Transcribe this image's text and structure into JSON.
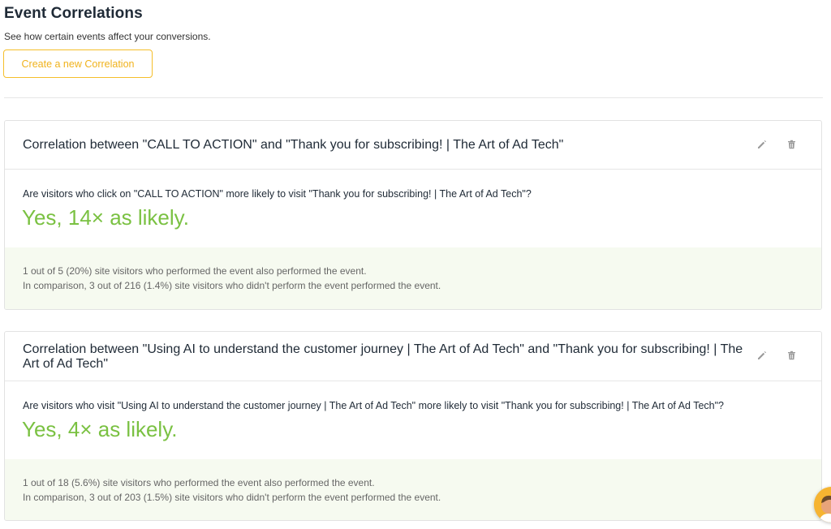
{
  "header": {
    "title": "Event Correlations",
    "subtitle": "See how certain events affect your conversions.",
    "create_button": "Create a new Correlation"
  },
  "correlations": [
    {
      "title": "Correlation between \"CALL TO ACTION\" and \"Thank you for subscribing! | The Art of Ad Tech\"",
      "question": "Are visitors who click on \"CALL TO ACTION\" more likely to visit \"Thank you for subscribing! | The Art of Ad Tech\"?",
      "answer": "Yes, 14× as likely.",
      "stat1": "1 out of 5 (20%) site visitors who performed the event also performed the event.",
      "stat2": "In comparison, 3 out of 216 (1.4%) site visitors who didn't perform the event performed the event."
    },
    {
      "title": "Correlation between \"Using AI to understand the customer journey | The Art of Ad Tech\" and \"Thank you for subscribing! | The Art of Ad Tech\"",
      "question": "Are visitors who visit \"Using AI to understand the customer journey | The Art of Ad Tech\" more likely to visit \"Thank you for subscribing! | The Art of Ad Tech\"?",
      "answer": "Yes, 4× as likely.",
      "stat1": "1 out of 18 (5.6%) site visitors who performed the event also performed the event.",
      "stat2": "In comparison, 3 out of 203 (1.5%) site visitors who didn't perform the event performed the event."
    }
  ],
  "icons": {
    "edit": "pencil-icon",
    "delete": "trash-icon"
  },
  "colors": {
    "accent": "#f5be2a",
    "success": "#7ac142",
    "footer_bg": "#f6faf0"
  }
}
